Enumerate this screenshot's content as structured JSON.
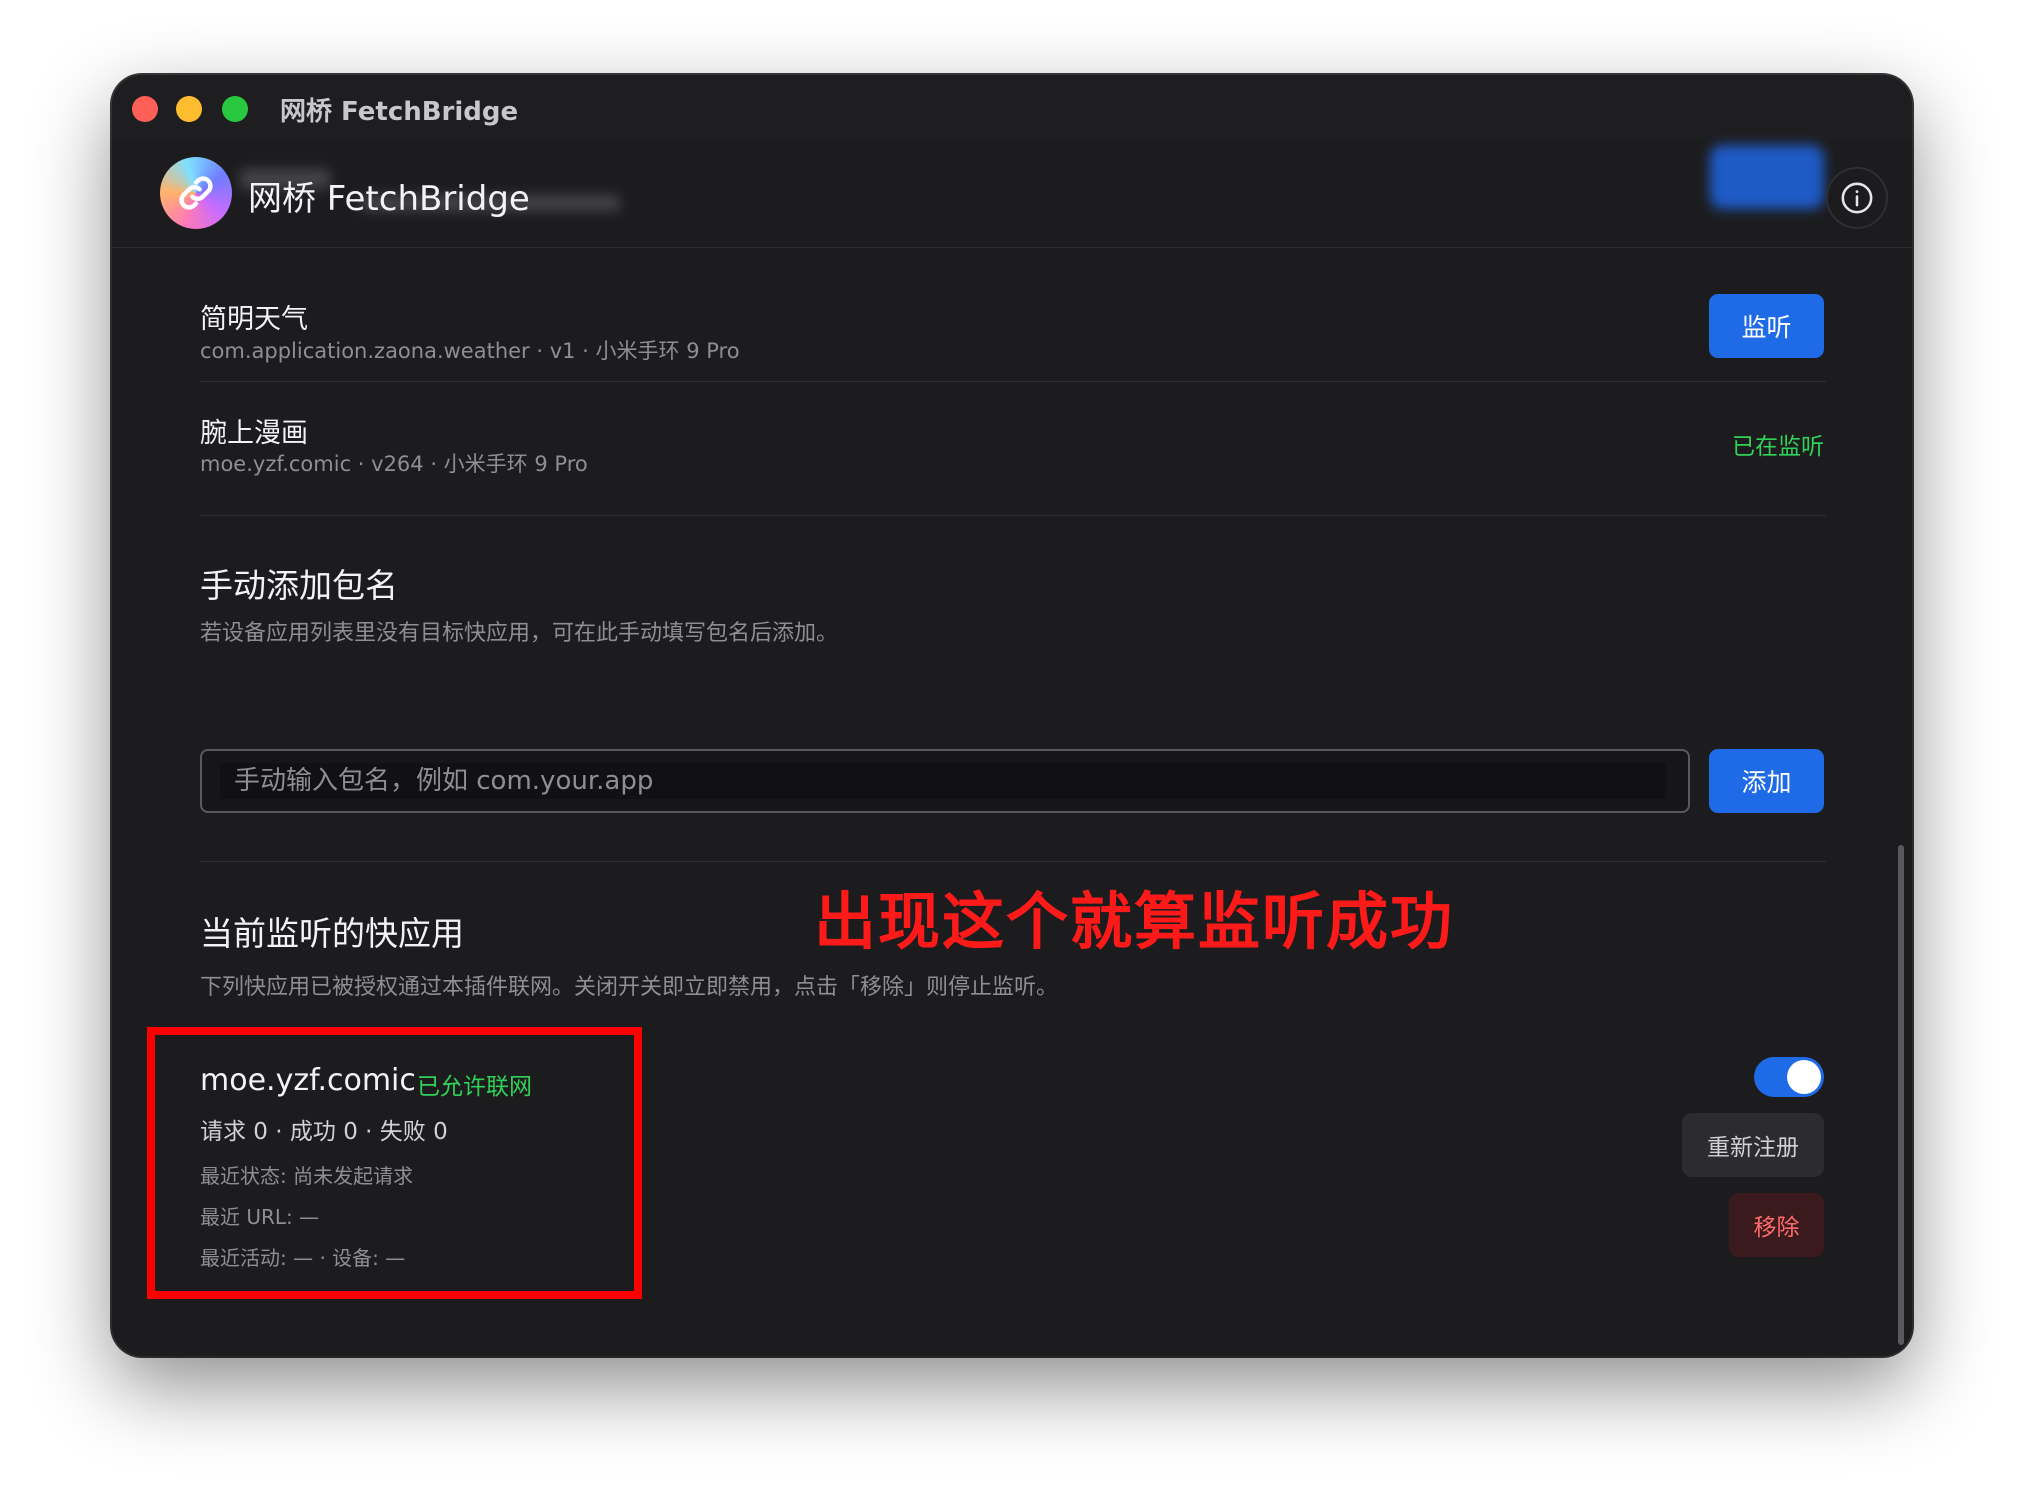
{
  "window": {
    "title": "网桥 FetchBridge"
  },
  "header": {
    "title": "网桥 FetchBridge",
    "info_icon": "info-circle-icon",
    "logo_icon": "link-icon"
  },
  "devices_apps": [
    {
      "name": "简明天气",
      "sub": "com.application.zaona.weather · v1 · 小米手环 9 Pro",
      "action": "监听"
    },
    {
      "name": "腕上漫画",
      "sub": "moe.yzf.comic · v264 · 小米手环 9 Pro",
      "status": "已在监听"
    }
  ],
  "manual_add": {
    "title": "手动添加包名",
    "desc": "若设备应用列表里没有目标快应用，可在此手动填写包名后添加。",
    "placeholder": "手动输入包名，例如 com.your.app",
    "button": "添加"
  },
  "annotation": "出现这个就算监听成功",
  "listening": {
    "title": "当前监听的快应用",
    "desc": "下列快应用已被授权通过本插件联网。关闭开关即立即禁用，点击「移除」则停止监听。",
    "items": [
      {
        "pkg": "moe.yzf.comic",
        "badge": "已允许联网",
        "stats": "请求 0 · 成功 0 · 失败 0",
        "recent_status": "最近状态: 尚未发起请求",
        "recent_url": "最近 URL: —",
        "recent_activity": "最近活动: — · 设备: —",
        "enabled": true,
        "reregister": "重新注册",
        "remove": "移除"
      }
    ]
  },
  "colors": {
    "accent": "#1f6ae6",
    "success": "#30d158",
    "danger": "#ff6b6b",
    "annotation": "#ff1a1a"
  }
}
